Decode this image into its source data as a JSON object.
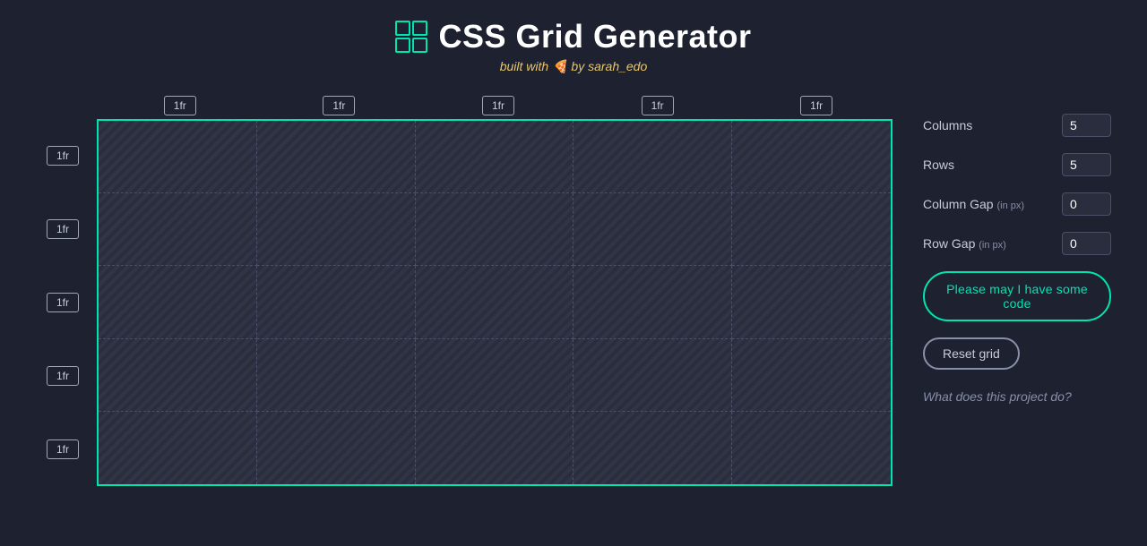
{
  "header": {
    "title": "CSS Grid Generator",
    "subtitle": "built with 🍕 by sarah_edo",
    "icon_label": "grid-icon"
  },
  "column_labels": [
    "1fr",
    "1fr",
    "1fr",
    "1fr",
    "1fr"
  ],
  "row_labels": [
    "1fr",
    "1fr",
    "1fr",
    "1fr",
    "1fr"
  ],
  "controls": {
    "columns_label": "Columns",
    "columns_value": "5",
    "rows_label": "Rows",
    "rows_value": "5",
    "col_gap_label": "Column Gap",
    "col_gap_unit": "(in px)",
    "col_gap_value": "0",
    "row_gap_label": "Row Gap",
    "row_gap_unit": "(in px)",
    "row_gap_value": "0",
    "code_button": "Please may I have some code",
    "reset_button": "Reset grid",
    "what_does": "What does this project do?"
  }
}
